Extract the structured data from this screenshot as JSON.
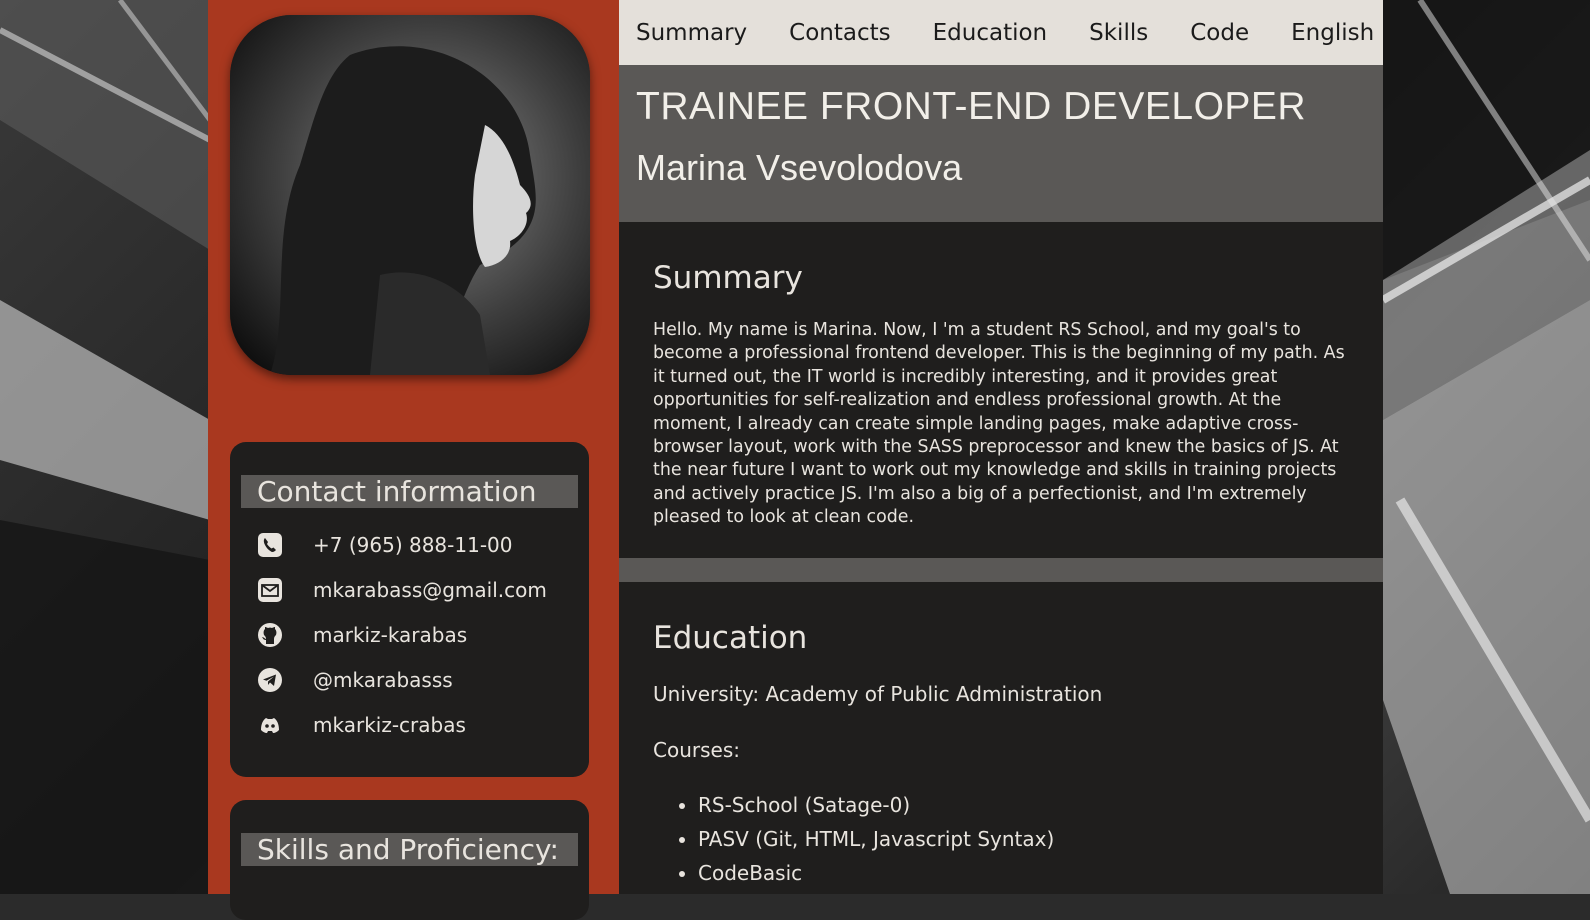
{
  "nav": {
    "items": [
      "Summary",
      "Contacts",
      "Education",
      "Skills",
      "Code",
      "English"
    ]
  },
  "header": {
    "job_title": "TRAINEE FRONT-END DEVELOPER",
    "name": "Marina Vsevolodova"
  },
  "sidebar": {
    "contact": {
      "heading": "Contact information",
      "items": [
        {
          "icon": "phone-icon",
          "text": "+7 (965) 888-11-00"
        },
        {
          "icon": "mail-icon",
          "text": "mkarabass@gmail.com"
        },
        {
          "icon": "github-icon",
          "text": "markiz-karabas"
        },
        {
          "icon": "telegram-icon",
          "text": "@mkarabasss"
        },
        {
          "icon": "discord-icon",
          "text": "mkarkiz-crabas"
        }
      ]
    },
    "skills": {
      "heading": "Skills and Proficiency:"
    }
  },
  "summary": {
    "title": "Summary",
    "text": "Hello. My name is Marina. Now, I 'm a student RS School, and my goal's to become a professional frontend developer. This is the beginning of my path. As it turned out, the IT world is incredibly interesting, and it provides great opportunities for self-realization and endless professional growth. At the moment, I already can create simple landing pages, make adaptive cross-browser layout, work with the SASS preprocessor and knew the basics of JS. At the near future I want to work out my knowledge and skills in training projects and actively practice JS. I'm also a big of a perfectionist, and I'm extremely pleased to look at clean code."
  },
  "education": {
    "title": "Education",
    "university": "University: Academy of Public Administration",
    "courses_label": "Courses:",
    "courses": [
      "RS-School (Satage-0)",
      "PASV (Git, HTML, Javascript Syntax)",
      "CodeBasic"
    ]
  },
  "colors": {
    "sidebar": "#a9381f",
    "panel": "#1f1e1d",
    "header": "#5a5856",
    "nav": "#e4e0da"
  }
}
